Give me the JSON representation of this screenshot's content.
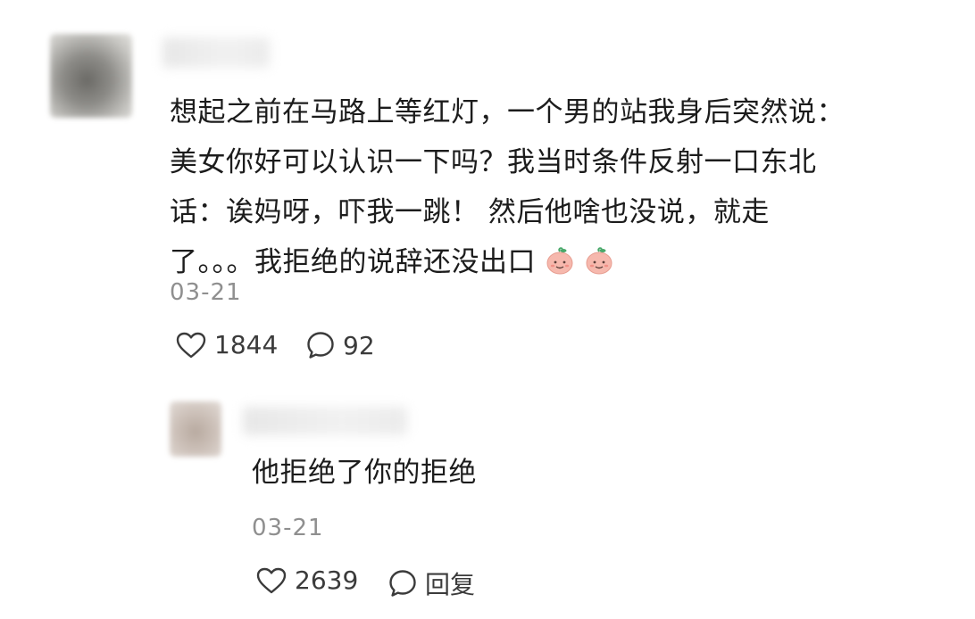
{
  "comment": {
    "text_lines": [
      "想起之前在马路上等红灯，一个男的站我身后突然说：",
      "美女你好可以认识一下吗？我当时条件反射一口东北",
      "话：诶妈呀，吓我一跳！ 然后他啥也没说，就走",
      "了。。。我拒绝的说辞还没出口"
    ],
    "emojis": [
      "peach-face-emoji",
      "peach-face-emoji"
    ],
    "date": "03-21",
    "likes": "1844",
    "replies": "92"
  },
  "reply": {
    "text": "他拒绝了你的拒绝",
    "date": "03-21",
    "likes": "2639",
    "reply_label": "回复"
  },
  "icons": {
    "like": "heart-outline-icon",
    "comment": "speech-bubble-icon"
  },
  "colors": {
    "text": "#1c1c1c",
    "meta": "#8f8f8f",
    "action": "#3b3b3b",
    "emoji_fill": "#f6b8ad",
    "emoji_leaf": "#49a86a"
  }
}
